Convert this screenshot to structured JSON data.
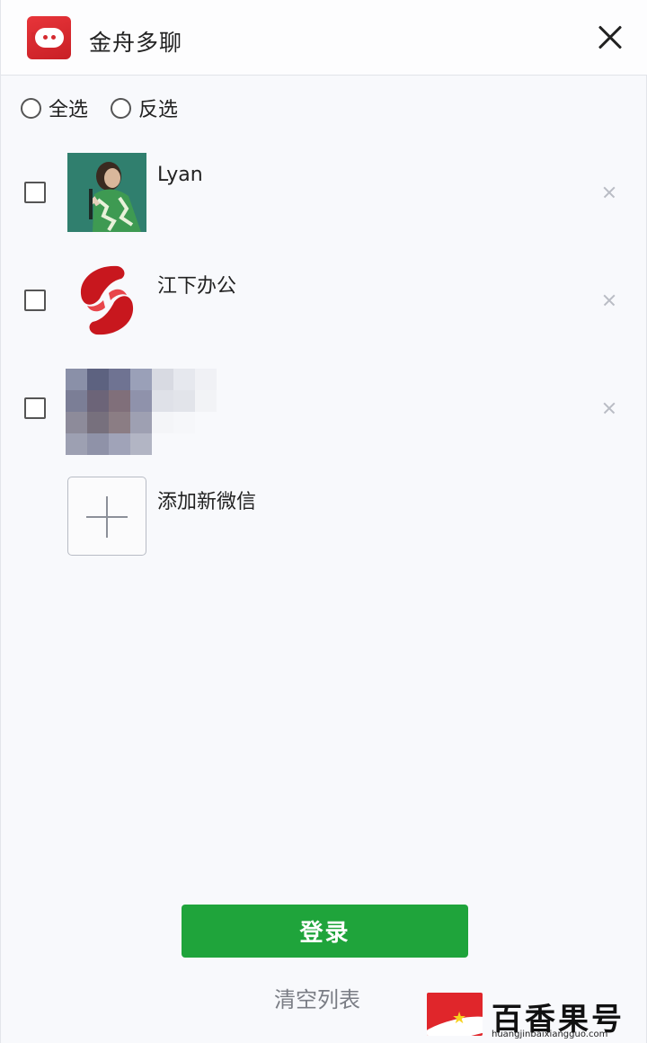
{
  "app": {
    "title": "金舟多聊"
  },
  "selection": {
    "select_all": "全选",
    "invert": "反选"
  },
  "accounts": [
    {
      "name": "Lyan"
    },
    {
      "name": "江下办公"
    },
    {
      "name": ""
    }
  ],
  "add_account": {
    "label": "添加新微信"
  },
  "actions": {
    "login": "登录",
    "clear_list": "清空列表"
  },
  "watermark": {
    "text": "百香果号",
    "url": "huangjinbaixiangguo.com"
  },
  "colors": {
    "primary_green": "#1fa43b",
    "brand_red": "#d52a2f"
  }
}
